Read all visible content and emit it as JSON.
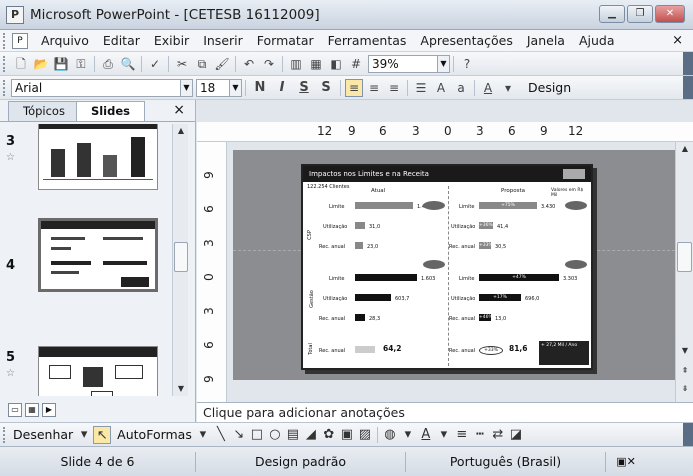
{
  "window": {
    "title": "Microsoft PowerPoint - [CETESB 16112009]"
  },
  "menu": {
    "items": [
      "Arquivo",
      "Editar",
      "Exibir",
      "Inserir",
      "Formatar",
      "Ferramentas",
      "Apresentações",
      "Janela",
      "Ajuda"
    ],
    "close": "×"
  },
  "toolbar": {
    "zoom": "39%"
  },
  "format_bar": {
    "font": "Arial",
    "size": "18",
    "bold": "N",
    "italic": "I",
    "underline": "S",
    "shadow": "S",
    "design_label": "Design"
  },
  "left_pane": {
    "tabs": [
      "Tópicos",
      "Slides"
    ],
    "close": "×",
    "thumbnails": [
      {
        "number": "3"
      },
      {
        "number": "4"
      },
      {
        "number": "5"
      }
    ]
  },
  "ruler": {
    "horizontal": [
      "12",
      "9",
      "6",
      "3",
      "0",
      "3",
      "6",
      "9",
      "12"
    ],
    "vertical": [
      "9",
      "6",
      "3",
      "0",
      "3",
      "6",
      "9"
    ]
  },
  "slide": {
    "title": "Impactos nos Limites e na Receita",
    "subtitle": "122.254 Clientes",
    "columns": [
      "Atual",
      "Proposta"
    ],
    "side_note": "Valores em R$ Mil",
    "row_labels": [
      "Limite",
      "Utilização",
      "Rec. anual"
    ],
    "group_labels": [
      "CSP",
      "Gestão",
      "Total"
    ],
    "left_values": [
      "1.430",
      "31,0",
      "23,0",
      "1.603",
      "603,7",
      "28,3"
    ],
    "right_values": [
      "3.430",
      "41,4",
      "30,5",
      "3.303",
      "696,0",
      "13,0"
    ],
    "right_pcts": [
      "+75%",
      "+36%",
      "+33%",
      "+47%",
      "+17%",
      "+46%"
    ],
    "total_left": "64,2",
    "total_right": "81,6",
    "total_pct": "+33%",
    "total_box": "+ 27,2 Mil / Ano"
  },
  "notes": {
    "text": "Clique para adicionar anotações"
  },
  "draw_toolbar": {
    "draw": "Desenhar",
    "autoshapes": "AutoFormas"
  },
  "status": {
    "slide": "Slide 4 de 6",
    "design": "Design padrão",
    "language": "Português (Brasil)"
  }
}
